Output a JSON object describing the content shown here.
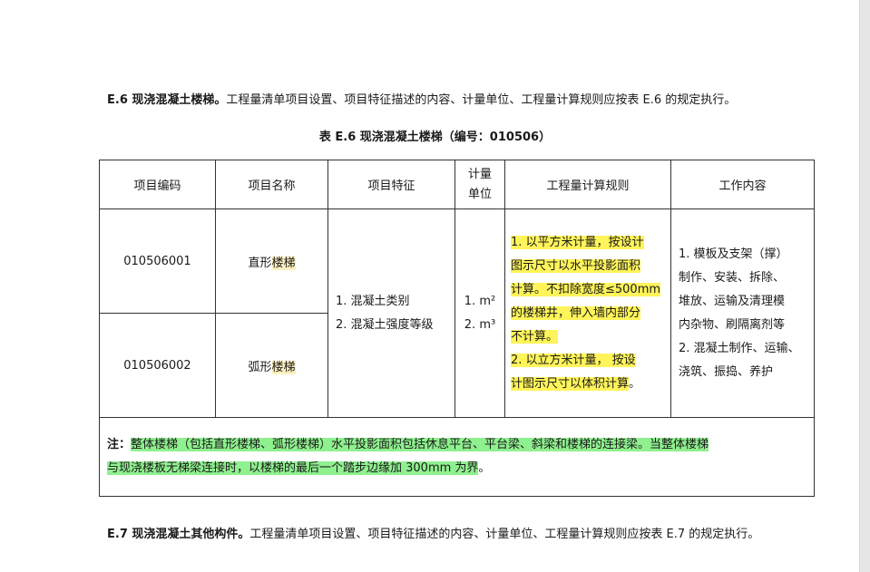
{
  "section_e6": {
    "heading": "E.6 现浇混凝土楼梯",
    "heading_tail": "。",
    "body": "工程量清单项目设置、项目特征描述的内容、计量单位、工程量计算规则应按表 E.6 的规定执行。"
  },
  "table_caption": "表 E.6 现浇混凝土楼梯（编号：010506）",
  "table": {
    "headers": {
      "code": "项目编码",
      "name": "项目名称",
      "features": "项目特征",
      "unit_line1": "计量",
      "unit_line2": "单位",
      "rules": "工程量计算规则",
      "work": "工作内容"
    },
    "rows": [
      {
        "code": "010506001",
        "name_prefix": "直形",
        "name_hl": "楼梯"
      },
      {
        "code": "010506002",
        "name_prefix": "弧形",
        "name_hl": "楼梯"
      }
    ],
    "features": [
      "1. 混凝土类别",
      "2. 混凝土强度等级"
    ],
    "units": [
      "1. m²",
      "2. m³"
    ],
    "rules_lines": [
      "1. 以平方米计量，按设计",
      "图示尺寸以水平投影面积",
      "计算。不扣除宽度≤500mm",
      "的楼梯井，伸入墙内部分",
      "不计算。",
      "2.  以立方米计量， 按设",
      "计图示尺寸以体积计算"
    ],
    "rules_end": "。",
    "work_lines": [
      "1. 模板及支架（撑）",
      "制作、安装、拆除、",
      "堆放、运输及清理模",
      "内杂物、刷隔离剂等",
      "2. 混凝土制作、运输、",
      "浇筑、振捣、养护"
    ],
    "note_label": "注：",
    "note_line1": "整体楼梯（包括直形楼梯、弧形楼梯）水平投影面积包括休息平台、平台梁、斜梁和楼梯的连接梁。当整体楼梯",
    "note_line2": "与现浇楼板无梯梁连接时，以楼梯的最后一个踏步边缘加 300mm 为界",
    "note_end": "。"
  },
  "section_e7": {
    "heading": "E.7 现浇混凝土其他构件",
    "heading_tail": "。",
    "body": "工程量清单项目设置、项目特征描述的内容、计量单位、工程量计算规则应按表 E.7 的规定执行。"
  },
  "colors": {
    "highlight_yellow": "#fff45a",
    "highlight_green": "#8ff08f",
    "highlight_word": "#fdf0c0"
  }
}
